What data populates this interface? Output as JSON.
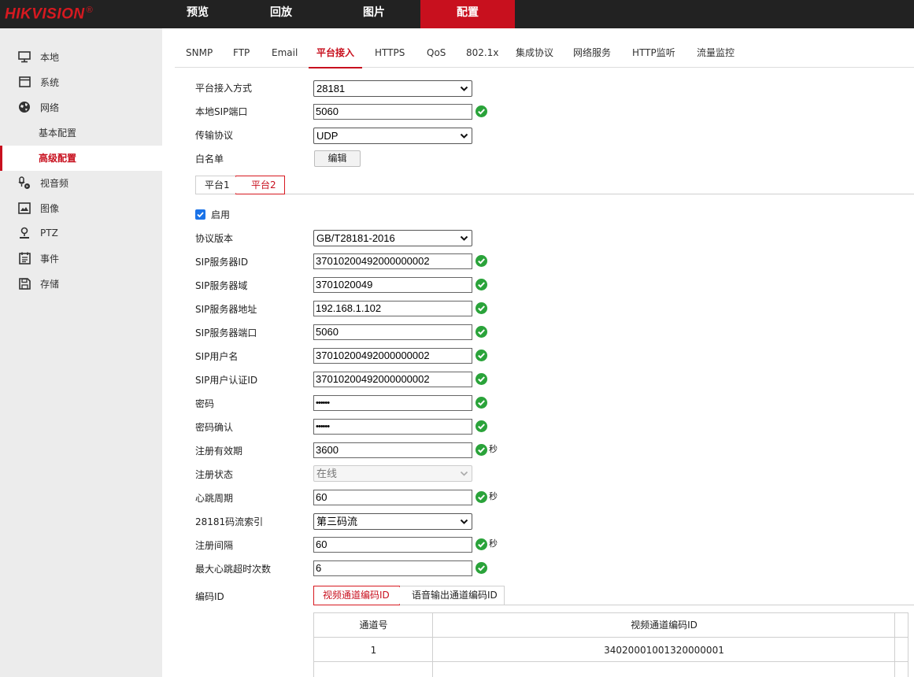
{
  "brand": {
    "logo_text": "HIKVISION",
    "logo_mark": "®",
    "accent": "#c8101e"
  },
  "topnav": [
    {
      "label": "预览"
    },
    {
      "label": "回放"
    },
    {
      "label": "图片"
    },
    {
      "label": "配置",
      "active": true
    }
  ],
  "sidebar": {
    "items": [
      {
        "label": "本地",
        "icon": "monitor-icon"
      },
      {
        "label": "系统",
        "icon": "system-window-icon"
      },
      {
        "label": "网络",
        "icon": "network-globe-icon"
      },
      {
        "label": "基本配置",
        "sub": true
      },
      {
        "label": "高级配置",
        "sub": true,
        "active": true
      },
      {
        "label": "视音频",
        "icon": "audio-video-icon"
      },
      {
        "label": "图像",
        "icon": "image-icon"
      },
      {
        "label": "PTZ",
        "icon": "ptz-icon"
      },
      {
        "label": "事件",
        "icon": "event-calendar-icon"
      },
      {
        "label": "存储",
        "icon": "storage-save-icon"
      }
    ]
  },
  "tabs": [
    "SNMP",
    "FTP",
    "Email",
    "平台接入",
    "HTTPS",
    "QoS",
    "802.1x",
    "集成协议",
    "网络服务",
    "HTTP监听",
    "流量监控"
  ],
  "active_tab": "平台接入",
  "form_top": {
    "access_mode": {
      "label": "平台接入方式",
      "value": "28181"
    },
    "sip_port": {
      "label": "本地SIP端口",
      "value": "5060"
    },
    "transport": {
      "label": "传输协议",
      "value": "UDP"
    },
    "whitelist": {
      "label": "白名单",
      "button": "编辑"
    }
  },
  "platform_tabs": [
    "平台1",
    "平台2"
  ],
  "active_platform": "平台2",
  "enable": {
    "label": "启用",
    "checked": true
  },
  "fields": {
    "protocol_version": {
      "label": "协议版本",
      "value": "GB/T28181-2016"
    },
    "sip_server_id": {
      "label": "SIP服务器ID",
      "value": "37010200492000000002"
    },
    "sip_server_domain": {
      "label": "SIP服务器域",
      "value": "3701020049"
    },
    "sip_server_addr": {
      "label": "SIP服务器地址",
      "value": "192.168.1.102"
    },
    "sip_server_port": {
      "label": "SIP服务器端口",
      "value": "5060"
    },
    "sip_username": {
      "label": "SIP用户名",
      "value": "37010200492000000002"
    },
    "sip_auth_id": {
      "label": "SIP用户认证ID",
      "value": "37010200492000000002"
    },
    "password": {
      "label": "密码",
      "value": "••••••"
    },
    "password_confirm": {
      "label": "密码确认",
      "value": "••••••"
    },
    "reg_validity": {
      "label": "注册有效期",
      "value": "3600",
      "unit": "秒"
    },
    "reg_status": {
      "label": "注册状态",
      "value": "在线"
    },
    "heartbeat": {
      "label": "心跳周期",
      "value": "60",
      "unit": "秒"
    },
    "stream_index": {
      "label": "28181码流索引",
      "value": "第三码流"
    },
    "reg_interval": {
      "label": "注册间隔",
      "value": "60",
      "unit": "秒"
    },
    "max_heartbeat_timeout": {
      "label": "最大心跳超时次数",
      "value": "6"
    }
  },
  "encode": {
    "label": "编码ID",
    "tabs": [
      "视频通道编码ID",
      "语音输出通道编码ID"
    ],
    "table": {
      "columns": [
        "通道号",
        "视频通道编码ID"
      ],
      "rows": [
        {
          "channel": "1",
          "code": "34020001001320000001"
        }
      ]
    }
  },
  "colors": {
    "ok_green": "#2aa33a",
    "top_bg": "#222222",
    "sidebar_bg": "#ececec",
    "checkbox_blue": "#1a73e8"
  }
}
